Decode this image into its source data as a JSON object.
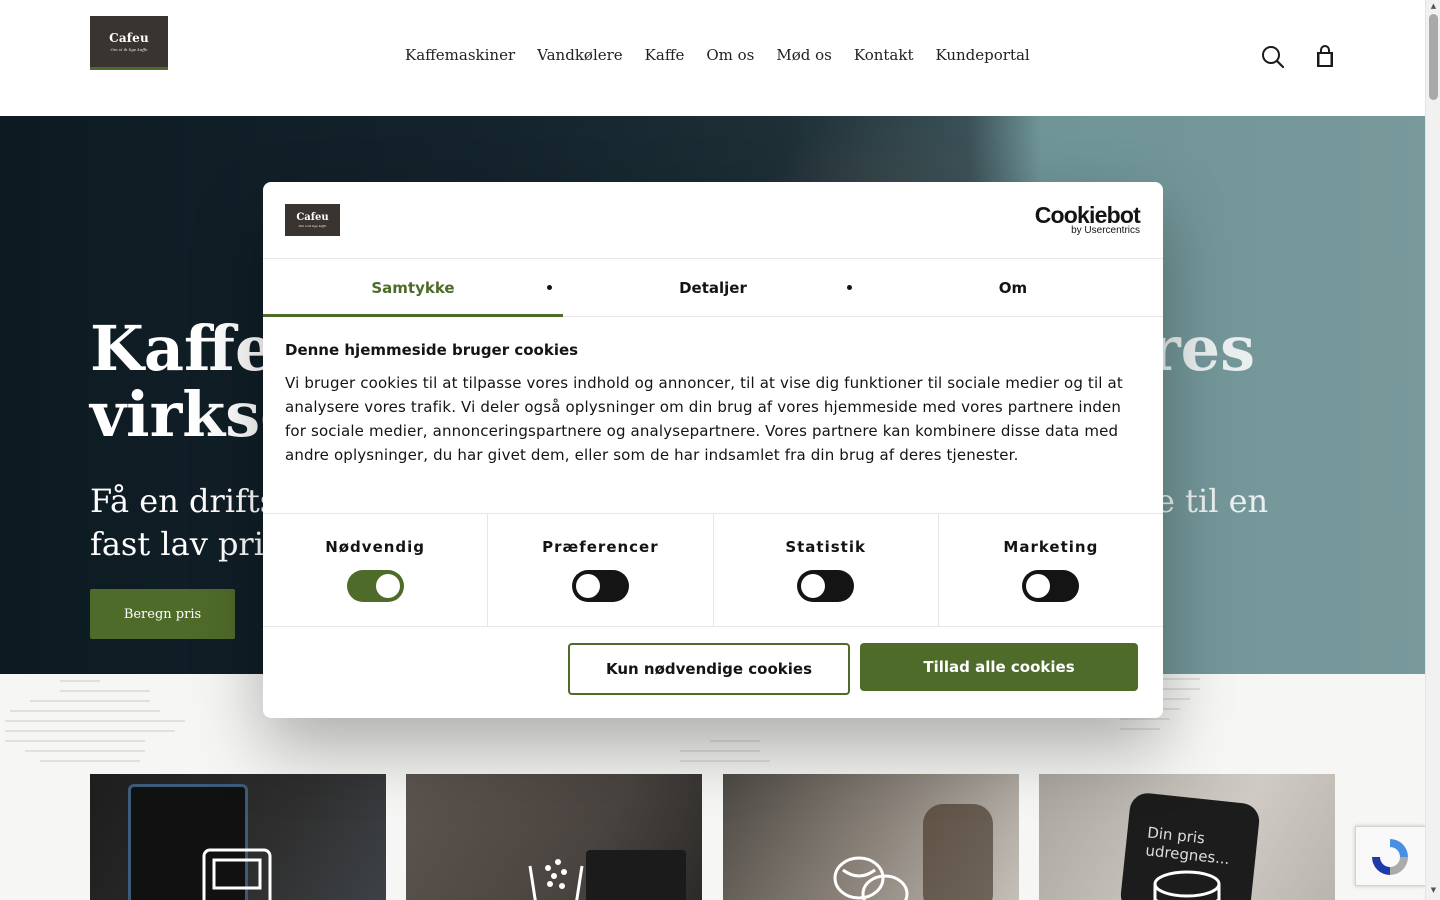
{
  "brand": {
    "logo_text": "Cafeu",
    "logo_tagline": "Om vi ik lige kaffe",
    "green": "#4f6b2a"
  },
  "nav": {
    "items": [
      "Kaffemaskiner",
      "Vandkølere",
      "Kaffe",
      "Om os",
      "Mød os",
      "Kontakt",
      "Kundeportal"
    ],
    "icons": [
      "search-icon",
      "shopping-bag-icon"
    ]
  },
  "hero": {
    "title_left": "Kaffel",
    "title_left_line2": "virkso",
    "title_right": "res",
    "sub_left_line1": "Få en drifts",
    "sub_left_line2": "fast lav pri",
    "sub_right": "e til en",
    "button": "Beregn pris"
  },
  "cards": {
    "c4_text": "Din pris\nudregnes..."
  },
  "cookie": {
    "provider_main": "Cookiebot",
    "provider_sub": "by Usercentrics",
    "tabs": [
      "Samtykke",
      "Detaljer",
      "Om"
    ],
    "active_tab": "Samtykke",
    "heading": "Denne hjemmeside bruger cookies",
    "body": "Vi bruger cookies til at tilpasse vores indhold og annoncer, til at vise dig funktioner til sociale medier og til at analysere vores trafik. Vi deler også oplysninger om din brug af vores hjemmeside med vores partnere inden for sociale medier, annonceringspartnere og analysepartnere. Vores partnere kan kombinere disse data med andre oplysninger, du har givet dem, eller som de har indsamlet fra din brug af deres tjenester.",
    "categories": [
      {
        "label": "Nødvendig",
        "on": true
      },
      {
        "label": "Præferencer",
        "on": false
      },
      {
        "label": "Statistik",
        "on": false
      },
      {
        "label": "Marketing",
        "on": false
      }
    ],
    "btn_necessary": "Kun nødvendige cookies",
    "btn_allow": "Tillad alle cookies"
  }
}
